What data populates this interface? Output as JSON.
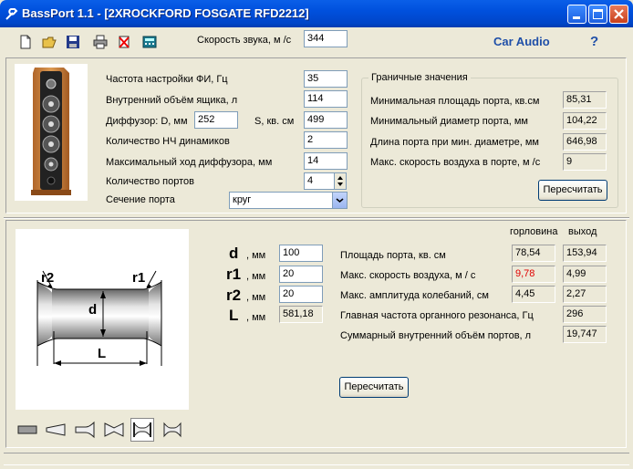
{
  "window": {
    "title": "BassPort 1.1 - [2XROCKFORD FOSGATE RFD2212]"
  },
  "toolbar": {
    "sound_speed_label": "Скорость звука, м /с",
    "sound_speed_value": "344",
    "brand": "Car Audio",
    "help": "?"
  },
  "params": {
    "tuning_label": "Частота настройки ФИ, Гц",
    "tuning_value": "35",
    "volume_label": "Внутренний объём ящика, л",
    "volume_value": "114",
    "diaphragm_label": "Диффузор: D, мм",
    "diaphragm_d_value": "252",
    "diaphragm_s_label": "S, кв. см",
    "diaphragm_s_value": "499",
    "drivers_label": "Количество НЧ динамиков",
    "drivers_value": "2",
    "xmax_label": "Максимальный ход диффузора, мм",
    "xmax_value": "14",
    "ports_label": "Количество портов",
    "ports_value": "4",
    "section_label": "Сечение порта",
    "section_value": "круг"
  },
  "limits": {
    "title": "Граничные значения",
    "min_area_label": "Минимальная площадь порта, кв.см",
    "min_area_value": "85,31",
    "min_diam_label": "Минимальный диаметр порта, мм",
    "min_diam_value": "104,22",
    "port_len_label": "Длина порта при мин. диаметре, мм",
    "port_len_value": "646,98",
    "max_air_label": "Макс. скорость воздуха в порте, м /с",
    "max_air_value": "9",
    "recalc": "Пересчитать"
  },
  "port": {
    "d_label": "d",
    "d_unit": ", мм",
    "d_value": "100",
    "r1_label": "r1",
    "r1_unit": ", мм",
    "r1_value": "20",
    "r2_label": "r2",
    "r2_unit": ", мм",
    "r2_value": "20",
    "l_label": "L",
    "l_unit": ", мм",
    "l_value": "581,18",
    "diagram": {
      "r2": "r2",
      "r1": "r1",
      "d": "d",
      "L": "L"
    }
  },
  "results": {
    "col_throat": "горловина",
    "col_exit": "выход",
    "rows": [
      {
        "label": "Площадь порта, кв. см",
        "throat": "78,54",
        "exit": "153,94"
      },
      {
        "label": "Макс. скорость воздуха, м / с",
        "throat": "9,78",
        "exit": "4,99"
      },
      {
        "label": "Макс. амплитуда колебаний, см",
        "throat": "4,45",
        "exit": "2,27"
      },
      {
        "label": "Главная частота органного резонанса, Гц",
        "exit": "296"
      },
      {
        "label": "Суммарный внутренний объём портов, л",
        "exit": "19,747"
      }
    ],
    "recalc": "Пересчитать"
  },
  "colors": {
    "warning": "#e00000",
    "brand": "#1f4fa8"
  }
}
